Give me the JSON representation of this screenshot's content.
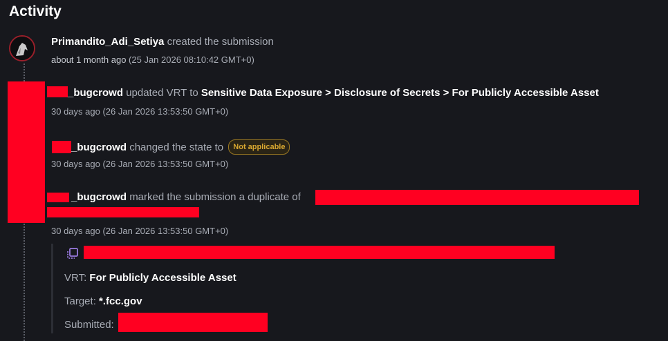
{
  "page": {
    "title": "Activity"
  },
  "events": [
    {
      "user": "Primandito_Adi_Setiya",
      "action": "created the submission",
      "relative_time": "about 1 month ago",
      "timestamp": "(25 Jan 2026 08:10:42 GMT+0)"
    },
    {
      "user": "_bugcrowd",
      "action": "updated VRT to",
      "value": "Sensitive Data Exposure > Disclosure of Secrets > For Publicly Accessible Asset",
      "relative_time": "30 days ago",
      "timestamp": "(26 Jan 2026 13:53:50 GMT+0)"
    },
    {
      "user": "_bugcrowd",
      "action": "changed the state to",
      "badge": "Not applicable",
      "relative_time": "30 days ago",
      "timestamp": "(26 Jan 2026 13:53:50 GMT+0)"
    },
    {
      "user": "_bugcrowd",
      "action": "marked the submission a duplicate of",
      "relative_time": "30 days ago",
      "timestamp": "(26 Jan 2026 13:53:50 GMT+0)"
    }
  ],
  "duplicate": {
    "icon": "duplicate-icon",
    "vrt_label": "VRT:",
    "vrt_value": "For Publicly Accessible Asset",
    "target_label": "Target:",
    "target_value": "*.fcc.gov",
    "submitted_label": "Submitted:"
  },
  "colors": {
    "redaction": "#ff0021",
    "badge": "#d8a730",
    "avatar_ring": "#9a1f2a"
  }
}
